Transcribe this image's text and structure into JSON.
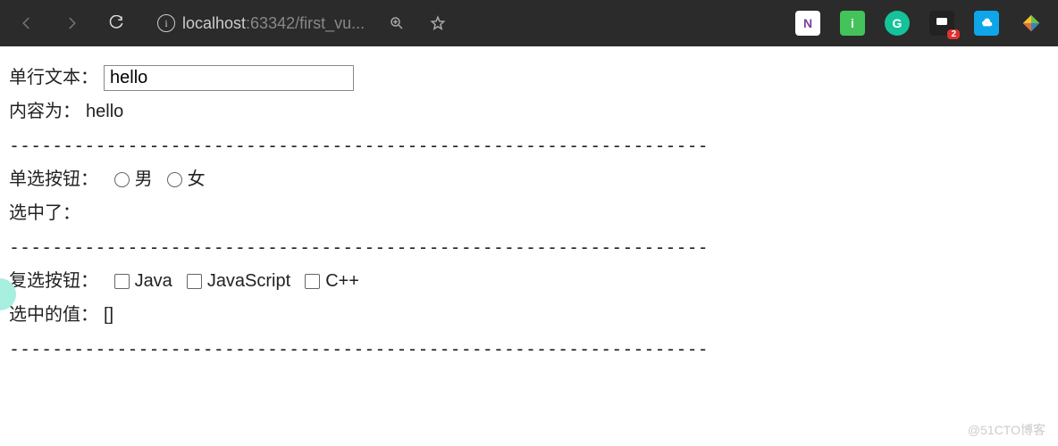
{
  "toolbar": {
    "url_host": "localhost",
    "url_port": ":63342",
    "url_path": "/first_vu...",
    "badge_count": "2"
  },
  "form": {
    "text_label": "单行文本：",
    "text_value": "hello",
    "content_label": "内容为：",
    "content_value": "hello",
    "radio_label": "单选按钮：",
    "radio_opt1": "男",
    "radio_opt2": "女",
    "radio_selected_label": "选中了：",
    "radio_selected_value": "",
    "checkbox_label": "复选按钮：",
    "checkbox_opt1": "Java",
    "checkbox_opt2": "JavaScript",
    "checkbox_opt3": "C++",
    "checkbox_selected_label": "选中的值：",
    "checkbox_selected_value": "[]",
    "divider": "-----------------------------------------------------------------"
  },
  "watermark": "@51CTO博客"
}
